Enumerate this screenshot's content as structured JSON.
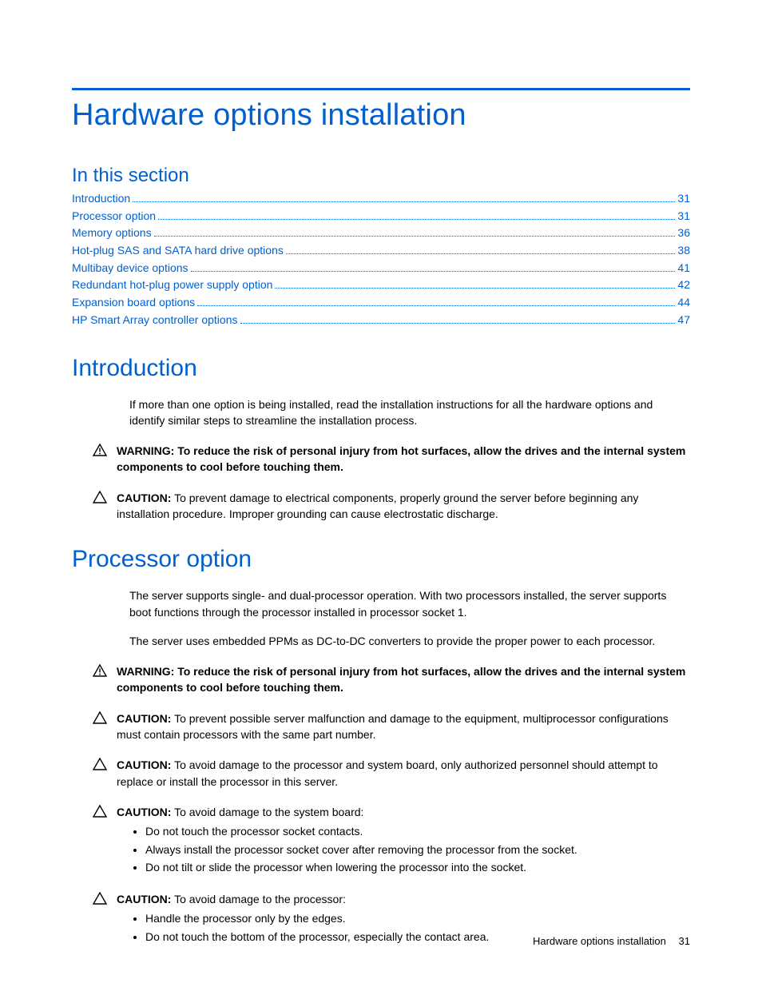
{
  "brand_color": "#0060d0",
  "page_title": "Hardware options installation",
  "in_this_section_label": "In this section",
  "toc": [
    {
      "label": "Introduction",
      "page": "31"
    },
    {
      "label": "Processor option",
      "page": "31"
    },
    {
      "label": "Memory options",
      "page": "36"
    },
    {
      "label": "Hot-plug SAS and SATA hard drive options",
      "page": "38"
    },
    {
      "label": "Multibay device options",
      "page": "41"
    },
    {
      "label": "Redundant hot-plug power supply option",
      "page": "42"
    },
    {
      "label": "Expansion board options",
      "page": "44"
    },
    {
      "label": "HP Smart Array controller options",
      "page": "47"
    }
  ],
  "sections": {
    "introduction": {
      "heading": "Introduction",
      "para1": "If more than one option is being installed, read the installation instructions for all the hardware options and identify similar steps to streamline the installation process.",
      "warning1_label": "WARNING:",
      "warning1_text": "  To reduce the risk of personal injury from hot surfaces, allow the drives and the internal system components to cool before touching them.",
      "caution1_label": "CAUTION:",
      "caution1_text": "  To prevent damage to electrical components, properly ground the server before beginning any installation procedure. Improper grounding can cause electrostatic discharge."
    },
    "processor": {
      "heading": "Processor option",
      "para1": "The server supports single- and dual-processor operation. With two processors installed, the server supports boot functions through the processor installed in processor socket 1.",
      "para2": "The server uses embedded PPMs as DC-to-DC converters to provide the proper power to each processor.",
      "warning1_label": "WARNING:",
      "warning1_text": "  To reduce the risk of personal injury from hot surfaces, allow the drives and the internal system components to cool before touching them.",
      "caution1_label": "CAUTION:",
      "caution1_text": "  To prevent possible server malfunction and damage to the equipment, multiprocessor configurations must contain processors with the same part number.",
      "caution2_label": "CAUTION:",
      "caution2_text": "  To avoid damage to the processor and system board, only authorized personnel should attempt to replace or install the processor in this server.",
      "caution3_label": "CAUTION:",
      "caution3_text": "  To avoid damage to the system board:",
      "caution3_bullets": [
        "Do not touch the processor socket contacts.",
        "Always install the processor socket cover after removing the processor from the socket.",
        "Do not tilt or slide the processor when lowering the processor into the socket."
      ],
      "caution4_label": "CAUTION:",
      "caution4_text": "  To avoid damage to the processor:",
      "caution4_bullets": [
        "Handle the processor only by the edges.",
        "Do not touch the bottom of the processor, especially the contact area."
      ]
    }
  },
  "footer": {
    "text": "Hardware options installation",
    "page_number": "31"
  }
}
